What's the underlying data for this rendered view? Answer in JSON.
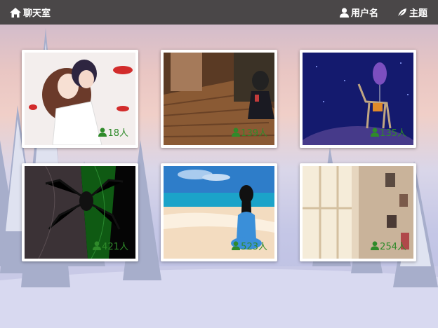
{
  "navbar": {
    "brand": "聊天室",
    "brand_icon": "home-icon",
    "user_label": "用户名",
    "user_icon": "user-icon",
    "theme_label": "主题",
    "theme_icon": "leaf-icon"
  },
  "rooms": [
    {
      "count": "18人",
      "image": "anime couple kissing"
    },
    {
      "count": "139人",
      "image": "anime girl sitting by window"
    },
    {
      "count": "135人",
      "image": "night sky with giraffe and balloon"
    },
    {
      "count": "421人",
      "image": "spider emblem black and green"
    },
    {
      "count": "523人",
      "image": "girl on beach facing sea"
    },
    {
      "count": "254人",
      "image": "blurred window room"
    }
  ]
}
